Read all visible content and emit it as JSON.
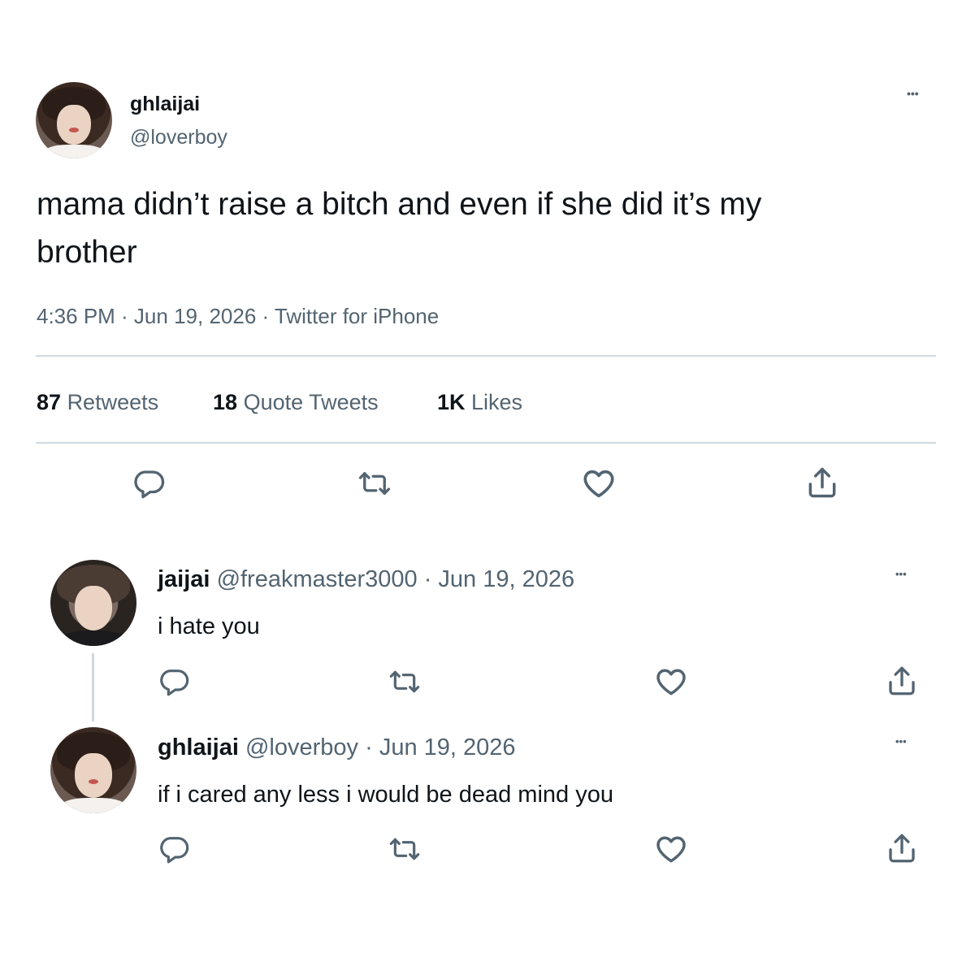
{
  "tweet": {
    "display_name": "ghlaijai",
    "handle": "@loverboy",
    "text_line1": "mama didn’t raise a bitch and even if she did it’s my",
    "text_line2": "brother",
    "meta": "4:36 PM · Jun 19, 2026 · Twitter for iPhone",
    "more": "•••"
  },
  "stats": {
    "retweets_count": "87",
    "retweets_label": "Retweets",
    "quotes_count": "18",
    "quotes_label": "Quote Tweets",
    "likes_count": "1K",
    "likes_label": "Likes"
  },
  "replies": [
    {
      "display_name": "jaijai",
      "handle": "@freakmaster3000",
      "date": "· Jun 19, 2026",
      "text": "i hate you",
      "more": "•••"
    },
    {
      "display_name": "ghlaijai",
      "handle": "@loverboy",
      "date": "· Jun 19, 2026",
      "text": "if i cared any less i would be dead mind you",
      "more": "•••"
    }
  ],
  "icons": {
    "reply": "reply-icon",
    "retweet": "retweet-icon",
    "like": "heart-icon",
    "share": "share-icon"
  },
  "colors": {
    "text": "#0f1419",
    "muted": "#536471",
    "divider": "#cfd9de"
  }
}
